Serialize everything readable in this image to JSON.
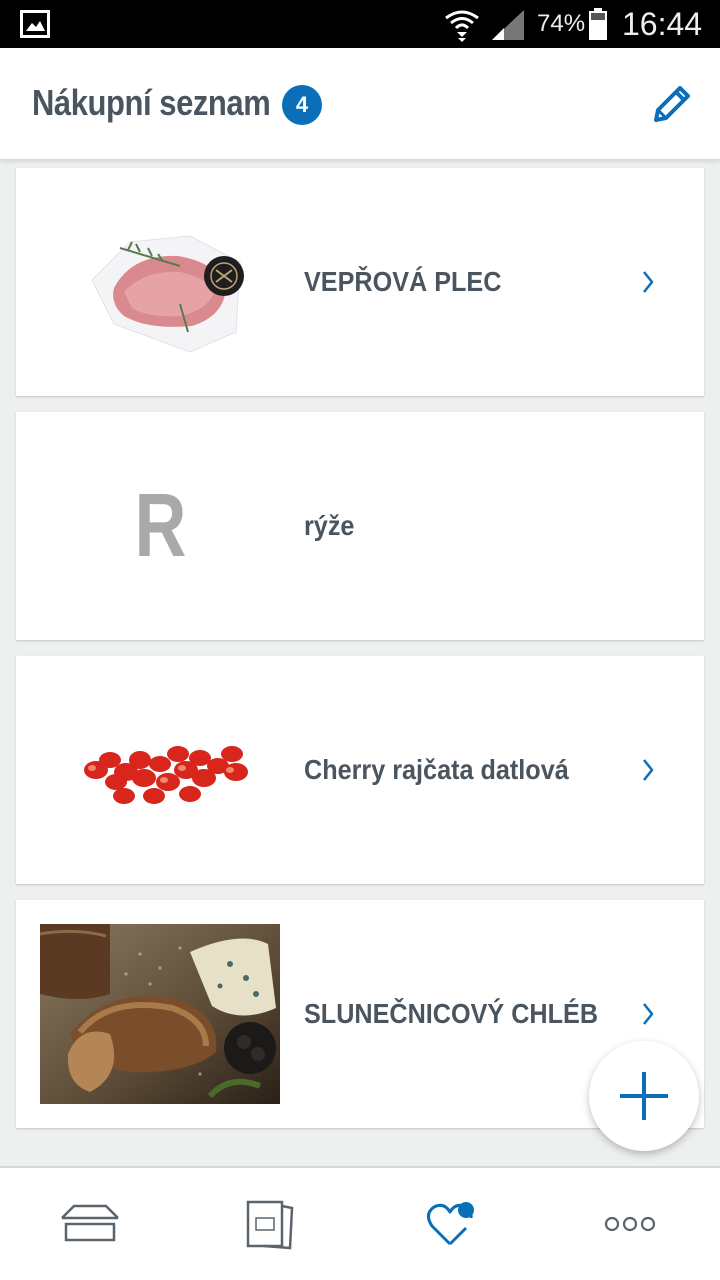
{
  "status_bar": {
    "battery_percent": "74%",
    "time": "16:44",
    "icons": [
      "gallery-icon",
      "wifi-icon",
      "signal-icon",
      "battery-icon"
    ]
  },
  "header": {
    "title": "Nákupní seznam",
    "item_count": "4",
    "edit_icon": "pencil-icon"
  },
  "shopping_list": {
    "items": [
      {
        "label": "VEPŘOVÁ PLEC",
        "thumbnail": "pork-shoulder-image",
        "has_detail": true
      },
      {
        "label": "rýže",
        "thumbnail_letter": "R",
        "has_detail": false
      },
      {
        "label": "Cherry rajčata datlová",
        "thumbnail": "cherry-tomatoes-image",
        "has_detail": true
      },
      {
        "label": "SLUNEČNICOVÝ CHLÉB",
        "thumbnail": "sunflower-bread-image",
        "has_detail": true
      }
    ]
  },
  "fab": {
    "icon": "plus-icon"
  },
  "bottom_nav": {
    "items": [
      {
        "icon": "store-icon"
      },
      {
        "icon": "leaflet-icon"
      },
      {
        "icon": "favorites-heart-icon",
        "active": true
      },
      {
        "icon": "more-icon"
      }
    ]
  },
  "colors": {
    "accent": "#0a6fb8",
    "text": "#4a5560",
    "background": "#eef0f0"
  }
}
